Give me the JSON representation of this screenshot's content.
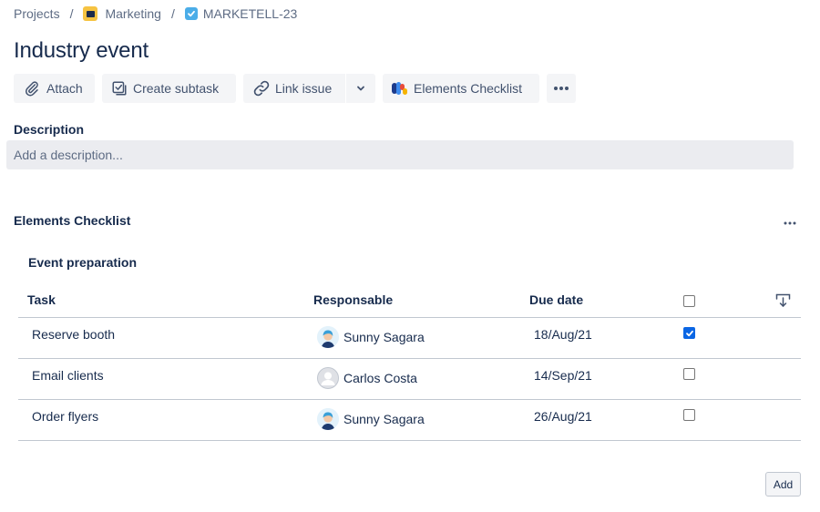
{
  "breadcrumb": {
    "projects": "Projects",
    "project": "Marketing",
    "issue_key": "MARKETELL-23",
    "separator": "/"
  },
  "issue": {
    "title": "Industry event"
  },
  "toolbar": {
    "attach": "Attach",
    "create_subtask": "Create subtask",
    "link_issue": "Link issue",
    "elements_checklist": "Elements Checklist"
  },
  "description": {
    "label": "Description",
    "placeholder": "Add a description..."
  },
  "checklist": {
    "title": "Elements Checklist",
    "group_title": "Event preparation",
    "columns": {
      "task": "Task",
      "responsable": "Responsable",
      "due_date": "Due date"
    },
    "rows": [
      {
        "task": "Reserve booth",
        "responsable": "Sunny Sagara",
        "avatar": "sunny-avatar",
        "due_date": "18/Aug/21",
        "done": true
      },
      {
        "task": "Email clients",
        "responsable": "Carlos Costa",
        "avatar": "default-avatar",
        "due_date": "14/Sep/21",
        "done": false
      },
      {
        "task": "Order flyers",
        "responsable": "Sunny Sagara",
        "avatar": "sunny-avatar",
        "due_date": "26/Aug/21",
        "done": false
      }
    ],
    "add_label": "Add"
  },
  "colors": {
    "accent_blue": "#0b66e4",
    "text_primary": "#172b4d",
    "text_subtle": "#5e6c84",
    "button_bg": "#f4f5f7",
    "project_icon": "#f6c342",
    "task_icon": "#4bade8"
  }
}
